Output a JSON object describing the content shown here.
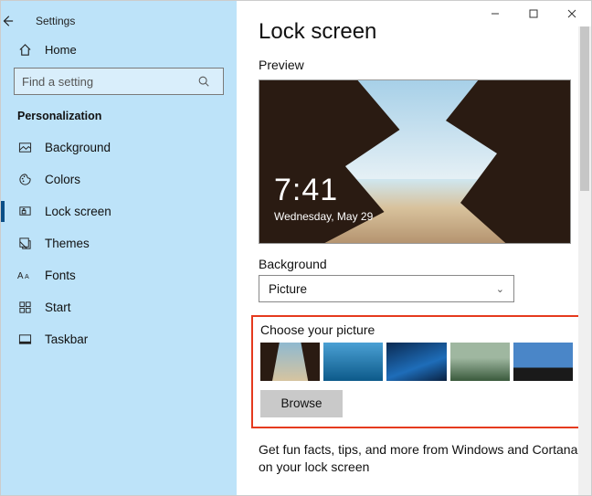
{
  "app": {
    "title": "Settings"
  },
  "sidebar": {
    "home": "Home",
    "search_placeholder": "Find a setting",
    "section": "Personalization",
    "items": [
      {
        "label": "Background"
      },
      {
        "label": "Colors"
      },
      {
        "label": "Lock screen"
      },
      {
        "label": "Themes"
      },
      {
        "label": "Fonts"
      },
      {
        "label": "Start"
      },
      {
        "label": "Taskbar"
      }
    ]
  },
  "main": {
    "title": "Lock screen",
    "preview_label": "Preview",
    "clock": {
      "time": "7:41",
      "date": "Wednesday, May 29"
    },
    "background_label": "Background",
    "background_value": "Picture",
    "choose_label": "Choose your picture",
    "browse_label": "Browse",
    "footer": "Get fun facts, tips, and more from Windows and Cortana on your lock screen"
  }
}
